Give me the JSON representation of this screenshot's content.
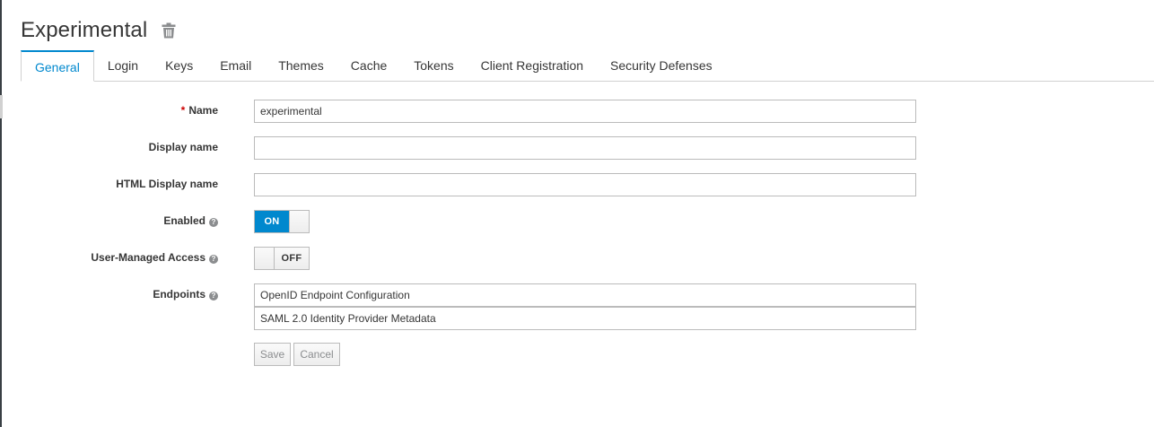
{
  "header": {
    "title": "Experimental"
  },
  "tabs": [
    {
      "label": "General",
      "active": true
    },
    {
      "label": "Login"
    },
    {
      "label": "Keys"
    },
    {
      "label": "Email"
    },
    {
      "label": "Themes"
    },
    {
      "label": "Cache"
    },
    {
      "label": "Tokens"
    },
    {
      "label": "Client Registration"
    },
    {
      "label": "Security Defenses"
    }
  ],
  "form": {
    "name": {
      "required_mark": "*",
      "label": "Name",
      "value": "experimental"
    },
    "display_name": {
      "label": "Display name",
      "value": ""
    },
    "html_display_name": {
      "label": "HTML Display name",
      "value": ""
    },
    "enabled": {
      "label": "Enabled",
      "state": "ON"
    },
    "user_managed_access": {
      "label": "User-Managed Access",
      "state": "OFF"
    },
    "endpoints": {
      "label": "Endpoints",
      "links": [
        "OpenID Endpoint Configuration",
        "SAML 2.0 Identity Provider Metadata"
      ]
    },
    "save_label": "Save",
    "cancel_label": "Cancel"
  },
  "icons": {
    "delete": "trash-icon",
    "help": "question-circle-icon"
  },
  "colors": {
    "accent": "#0088ce",
    "required": "#cc0000"
  }
}
